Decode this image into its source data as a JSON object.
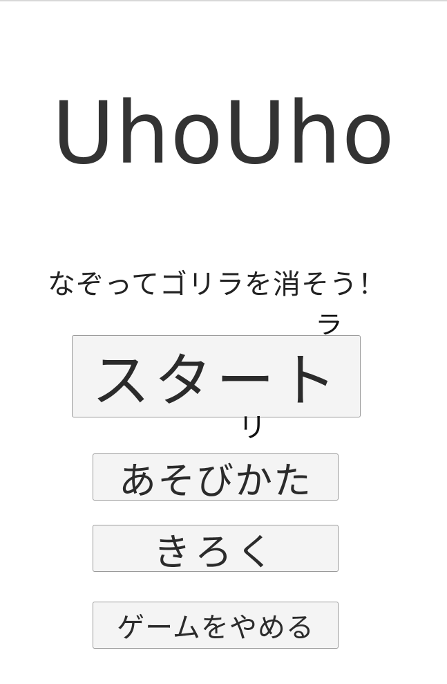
{
  "app": {
    "title": "UhoUho",
    "tagline": "なぞってゴリラを消そう！"
  },
  "menu": {
    "start_label": "スタート",
    "howto_label": "あそびかた",
    "record_label": "きろく",
    "quit_label": "ゲームをやめる"
  },
  "falling": {
    "char_1": "ラ",
    "char_2": "リ"
  }
}
